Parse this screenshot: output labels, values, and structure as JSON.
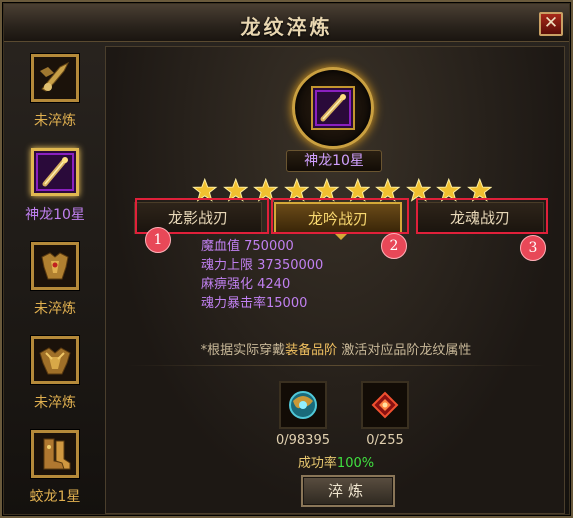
{
  "window": {
    "title": "龙纹淬炼",
    "close_label": "✕"
  },
  "sidebar": {
    "items": [
      {
        "label": "未淬炼",
        "icon": "blade-icon",
        "label_color": "gold",
        "selected": false
      },
      {
        "label": "神龙10星",
        "icon": "staff-icon",
        "label_color": "purple",
        "selected": true
      },
      {
        "label": "未淬炼",
        "icon": "armor-icon",
        "label_color": "gold",
        "selected": false
      },
      {
        "label": "未淬炼",
        "icon": "armor-icon",
        "label_color": "gold",
        "selected": false
      },
      {
        "label": "蛟龙1星",
        "icon": "boots-icon",
        "label_color": "gold",
        "selected": false
      }
    ]
  },
  "center": {
    "name": "神龙10星",
    "icon": "staff-icon"
  },
  "stars": {
    "filled": 10,
    "total": 10
  },
  "tabs": [
    {
      "label": "龙影战刃",
      "badge": "1",
      "active": false
    },
    {
      "label": "龙吟战刃",
      "badge": "2",
      "active": true
    },
    {
      "label": "龙魂战刃",
      "badge": "3",
      "active": false
    }
  ],
  "attributes": [
    {
      "text": "魔血值 750000"
    },
    {
      "text": "魂力上限 37350000"
    },
    {
      "text": "麻痹强化 4240"
    },
    {
      "text": "魂力暴击率15000"
    }
  ],
  "hint": {
    "prefix": "*根据实际穿戴",
    "highlight": "装备品阶",
    "suffix": " 激活对应品阶龙纹属性"
  },
  "materials": [
    {
      "count": "0/98395",
      "icon": "orb-icon"
    },
    {
      "count": "0/255",
      "icon": "crystal-icon"
    }
  ],
  "success": {
    "label": "成功率",
    "value": "100%"
  },
  "temper_button": {
    "label": "淬炼"
  },
  "colors": {
    "accent_gold": "#d4a838",
    "attr_purple": "#c080f0",
    "highlight_red": "#e0203a",
    "success_green": "#40e040"
  }
}
